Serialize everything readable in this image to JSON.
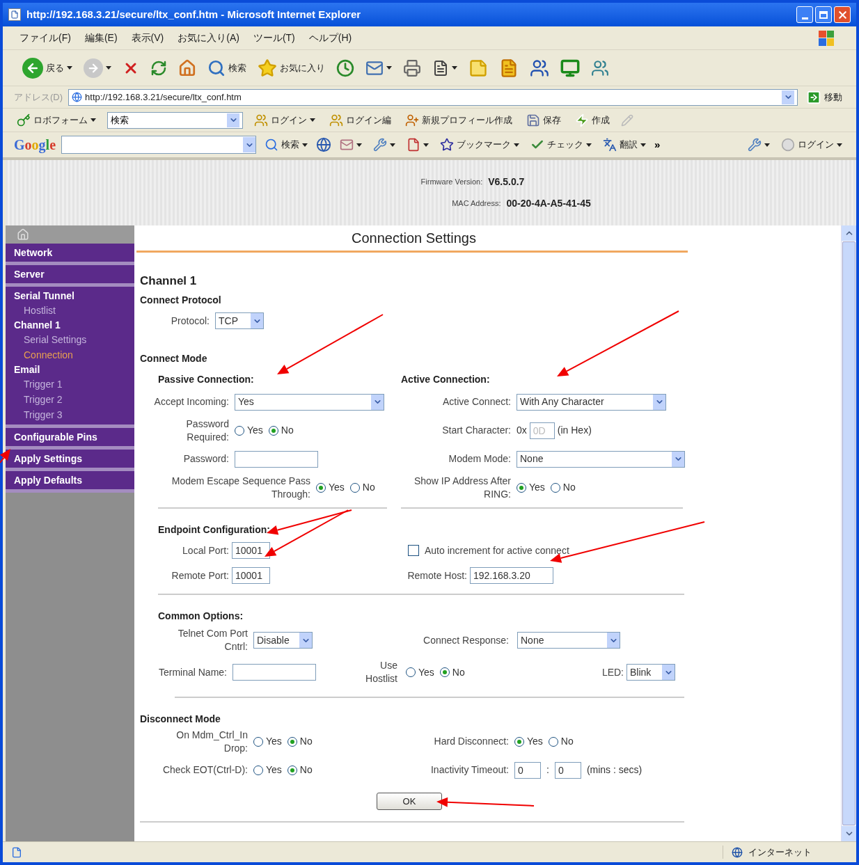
{
  "window": {
    "title": "http://192.168.3.21/secure/ltx_conf.htm - Microsoft Internet Explorer"
  },
  "menu_bar": [
    "ファイル(F)",
    "編集(E)",
    "表示(V)",
    "お気に入り(A)",
    "ツール(T)",
    "ヘルプ(H)"
  ],
  "toolbar": {
    "back": "戻る",
    "search": "検索",
    "favorites": "お気に入り"
  },
  "address_bar": {
    "label": "アドレス(D)",
    "url": "http://192.168.3.21/secure/ltx_conf.htm",
    "go": "移動"
  },
  "links_bar": {
    "roboform": "ロボフォーム",
    "search_value": "検索",
    "login": "ログイン",
    "login_edit": "ログイン編",
    "new_profile": "新規プロフィール作成",
    "save": "保存",
    "create": "作成"
  },
  "google_bar": {
    "logo": "Google",
    "search": "検索",
    "bookmarks": "ブックマーク",
    "check": "チェック",
    "translate": "翻訳",
    "more": "»",
    "login": "ログイン"
  },
  "header": {
    "firmware_label": "Firmware Version:",
    "firmware": "V6.5.0.7",
    "mac_label": "MAC Address:",
    "mac": "00-20-4A-A5-41-45"
  },
  "sidebar": {
    "sections": [
      {
        "items": [
          {
            "label": "Network",
            "selected": false
          }
        ]
      },
      {
        "items": [
          {
            "label": "Server",
            "selected": false
          }
        ]
      },
      {
        "items": [
          {
            "label": "Serial Tunnel",
            "selected": false,
            "children": [
              {
                "label": "Hostlist",
                "selected": false
              }
            ]
          },
          {
            "label": "Channel 1",
            "selected": false,
            "children": [
              {
                "label": "Serial Settings",
                "selected": false
              },
              {
                "label": "Connection",
                "selected": true
              }
            ]
          },
          {
            "label": "Email",
            "selected": false,
            "children": [
              {
                "label": "Trigger 1",
                "selected": false
              },
              {
                "label": "Trigger 2",
                "selected": false
              },
              {
                "label": "Trigger 3",
                "selected": false
              }
            ]
          }
        ]
      },
      {
        "items": [
          {
            "label": "Configurable Pins",
            "selected": false
          }
        ]
      },
      {
        "items": [
          {
            "label": "Apply Settings",
            "selected": false
          }
        ]
      },
      {
        "items": [
          {
            "label": "Apply Defaults",
            "selected": false
          }
        ]
      }
    ]
  },
  "form": {
    "title": "Connection Settings",
    "channel": "Channel 1",
    "protocol": {
      "heading": "Connect Protocol",
      "field": {
        "kind": "select",
        "label": "Protocol:",
        "value": "TCP"
      }
    },
    "connect_mode": {
      "heading": "Connect Mode",
      "passive": {
        "heading": "Passive Connection:",
        "fields": [
          {
            "kind": "select",
            "label": "Accept Incoming:",
            "value": "Yes"
          },
          {
            "kind": "radio",
            "label": "Password Required:",
            "options": [
              {
                "label": "Yes",
                "selected": false
              },
              {
                "label": "No",
                "selected": true
              }
            ]
          },
          {
            "kind": "text",
            "label": "Password:"
          },
          {
            "kind": "radio",
            "label": "Modem Escape Sequence Pass Through:",
            "options": [
              {
                "label": "Yes",
                "selected": true
              },
              {
                "label": "No",
                "selected": false
              }
            ]
          }
        ]
      },
      "active": {
        "heading": "Active Connection:",
        "fields": [
          {
            "kind": "select",
            "label": "Active Connect:",
            "value": "With Any Character"
          },
          {
            "kind": "hex",
            "label": "Start Character:",
            "prefix": "0x",
            "value": "0D",
            "suffix": "(in Hex)",
            "disabled": true
          },
          {
            "kind": "select",
            "label": "Modem Mode:",
            "value": "None"
          },
          {
            "kind": "radio",
            "label": "Show IP Address After RING:",
            "options": [
              {
                "label": "Yes",
                "selected": true
              },
              {
                "label": "No",
                "selected": false
              }
            ]
          }
        ]
      }
    },
    "endpoint": {
      "heading": "Endpoint Configuration:",
      "fields": [
        {
          "kind": "text",
          "label": "Local Port:",
          "value": "10001"
        },
        {
          "kind": "text",
          "label": "Remote Port:",
          "value": "10001"
        }
      ],
      "auto_increment": {
        "label": "Auto increment for active connect",
        "checked": false
      },
      "remote_host": {
        "kind": "text",
        "label": "Remote Host:",
        "value": "192.168.3.20"
      }
    },
    "common": {
      "heading": "Common Options:",
      "fields": [
        {
          "kind": "select",
          "label": "Telnet Com Port Cntrl:",
          "value": "Disable"
        },
        {
          "kind": "select",
          "label": "Connect Response:",
          "value": "None"
        },
        {
          "kind": "text",
          "label": "Terminal Name:"
        },
        {
          "kind": "radio",
          "label": "Use Hostlist",
          "options": [
            {
              "label": "Yes",
              "selected": false
            },
            {
              "label": "No",
              "selected": true
            }
          ]
        },
        {
          "kind": "select",
          "label": "LED:",
          "value": "Blink"
        }
      ]
    },
    "disconnect": {
      "heading": "Disconnect Mode",
      "fields": [
        {
          "kind": "radio",
          "label": "On Mdm_Ctrl_In Drop:",
          "options": [
            {
              "label": "Yes",
              "selected": false
            },
            {
              "label": "No",
              "selected": true
            }
          ]
        },
        {
          "kind": "radio",
          "label": "Hard Disconnect:",
          "options": [
            {
              "label": "Yes",
              "selected": true
            },
            {
              "label": "No",
              "selected": false
            }
          ]
        },
        {
          "kind": "radio",
          "label": "Check EOT(Ctrl-D):",
          "options": [
            {
              "label": "Yes",
              "selected": false
            },
            {
              "label": "No",
              "selected": true
            }
          ]
        },
        {
          "kind": "timeout",
          "label": "Inactivity Timeout:",
          "minutes": "0",
          "separator": ":",
          "seconds": "0",
          "unit": "(mins : secs)"
        }
      ]
    },
    "ok": "OK"
  },
  "status_bar": {
    "zone": "インターネット"
  }
}
